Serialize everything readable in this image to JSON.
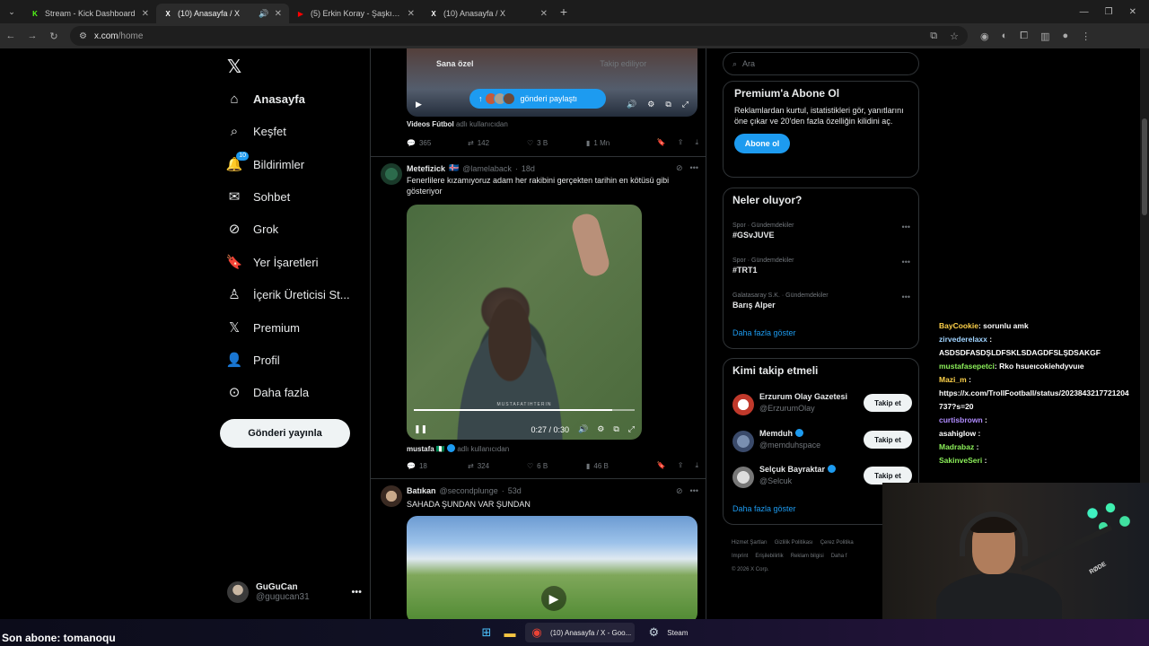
{
  "browser": {
    "tabs": [
      {
        "title": "Stream - Kick Dashboard",
        "favicon": "K",
        "color": "#53fc18"
      },
      {
        "title": "(10) Anasayfa / X",
        "favicon": "X",
        "color": "#ffffff",
        "active": true
      },
      {
        "title": "(5) Erkin Koray - Şaşkın - YouTube",
        "favicon": "▶",
        "color": "#ff0000"
      },
      {
        "title": "(10) Anasayfa / X",
        "favicon": "X",
        "color": "#ffffff"
      }
    ],
    "url_host": "x.com",
    "url_path": "/home"
  },
  "nav": {
    "items": [
      {
        "label": "Anasayfa",
        "icon": "home-icon",
        "glyph": "⌂"
      },
      {
        "label": "Keşfet",
        "icon": "search-icon",
        "glyph": "⌕"
      },
      {
        "label": "Bildirimler",
        "icon": "bell-icon",
        "glyph": "🔔",
        "badge": "10"
      },
      {
        "label": "Sohbet",
        "icon": "mail-icon",
        "glyph": "✉"
      },
      {
        "label": "Grok",
        "icon": "grok-icon",
        "glyph": "⊘"
      },
      {
        "label": "Yer İşaretleri",
        "icon": "bookmark-icon",
        "glyph": "🔖"
      },
      {
        "label": "İçerik Üreticisi St...",
        "icon": "creator-icon",
        "glyph": "♙"
      },
      {
        "label": "Premium",
        "icon": "x-premium-icon",
        "glyph": "𝕏"
      },
      {
        "label": "Profil",
        "icon": "person-icon",
        "glyph": "👤"
      },
      {
        "label": "Daha fazla",
        "icon": "more-circle-icon",
        "glyph": "⊙"
      }
    ],
    "post_button": "Gönderi yayınla",
    "me": {
      "name": "GuGuCan",
      "handle": "@gugucan31"
    }
  },
  "feed": {
    "tabs": [
      "Sana özel",
      "Takip ediliyor"
    ],
    "share_pill": "gönderi paylaştı",
    "top_post": {
      "source_name": "Videos Fútbol",
      "source_suffix": "adlı kullanıcıdan",
      "replies": "365",
      "reposts": "142",
      "likes": "3 B",
      "views": "1 Mn"
    },
    "post1": {
      "name": "Metefizick",
      "handle": "@lamelaback",
      "time": "18d",
      "text": "Fenerlilere kızamıyoruz adam her rakibini gerçekten tarihin en kötüsü gibi gösteriyor",
      "video_time": "0:27 / 0:30",
      "watermark": "MUSTAFATIHTERIN",
      "progress": 0.9,
      "source_name": "mustafa",
      "source_suffix": "adlı kullanıcıdan",
      "replies": "18",
      "reposts": "324",
      "likes": "6 B",
      "views": "46 B"
    },
    "post2": {
      "name": "Batıkan",
      "handle": "@secondplunge",
      "time": "53d",
      "text": "SAHADA ŞUNDAN VAR ŞUNDAN"
    }
  },
  "right": {
    "search_placeholder": "Ara",
    "premium": {
      "title": "Premium'a Abone Ol",
      "text": "Reklamlardan kurtul, istatistikleri gör, yanıtlarını öne çıkar ve 20'den fazla özelliğin kilidini aç.",
      "button": "Abone ol"
    },
    "trends": {
      "title": "Neler oluyor?",
      "items": [
        {
          "category": "Spor · Gündemdekiler",
          "name": "#GSvJUVE"
        },
        {
          "category": "Spor · Gündemdekiler",
          "name": "#TRT1"
        },
        {
          "category": "Galatasaray S.K. · Gündemdekiler",
          "name": "Barış Alper"
        }
      ],
      "more": "Daha fazla göster"
    },
    "who_to_follow": {
      "title": "Kimi takip etmeli",
      "items": [
        {
          "name": "Erzurum Olay Gazetesi",
          "handle": "@ErzurumOlay",
          "button": "Takip et"
        },
        {
          "name": "Memduh",
          "handle": "@memduhspace",
          "button": "Takip et"
        },
        {
          "name": "Selçuk Bayraktar",
          "handle": "@Selcuk",
          "button": "Takip et"
        }
      ],
      "more": "Daha fazla göster"
    },
    "footer": {
      "links1": [
        "Hizmet Şartları",
        "Gizlilik Politikası",
        "Çerez Politika"
      ],
      "links2": [
        "Imprint",
        "Erişilebilirlik",
        "Reklam bilgisi",
        "Daha f"
      ],
      "copyright": "© 2026 X Corp."
    }
  },
  "chat": [
    {
      "user": "BayCookie",
      "color": "#ffd24a",
      "msg": ": sorunlu amk"
    },
    {
      "user": "zirvederelaxx",
      "color": "#9fd3ff",
      "msg": " :"
    },
    {
      "user": "",
      "color": "#ffffff",
      "msg": "ASDSDFASDŞLDFSKLSDAGDFSLŞDSAKGF"
    },
    {
      "user": "mustafasepetci",
      "color": "#8cf05a",
      "msg": ": Rko hsueıcokiehdyvuıe"
    },
    {
      "user": "Mazi_m",
      "color": "#ffd24a",
      "msg": " :"
    },
    {
      "user": "",
      "color": "#ffffff",
      "msg": "https://x.com/TrollFootball/status/2023843217721204"
    },
    {
      "user": "",
      "color": "#ffffff",
      "msg": "737?s=20"
    },
    {
      "user": "curtisbrown",
      "color": "#b08cff",
      "msg": " :"
    },
    {
      "user": "asahiglow",
      "color": "#ffffff",
      "msg": " :"
    },
    {
      "user": "Madrabaz",
      "color": "#8cf05a",
      "msg": " :"
    },
    {
      "user": "SakinveSeri",
      "color": "#8cf05a",
      "msg": " :"
    }
  ],
  "overlay": {
    "last_sub": "Son abone: tomanoqu",
    "cam_brand": "RØDE"
  },
  "taskbar": {
    "chrome_label": "(10) Anasayfa / X - Goo...",
    "steam_label": "Steam"
  }
}
